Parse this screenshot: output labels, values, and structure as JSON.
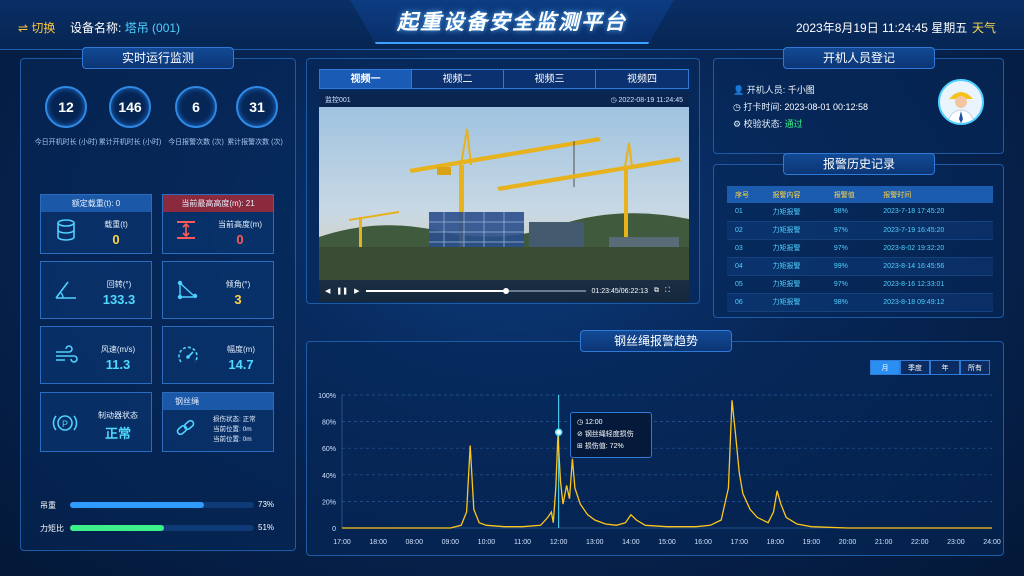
{
  "header": {
    "switch_label": "⇌ 切换",
    "device_label": "设备名称:",
    "device_name": "塔吊 (001)",
    "title": "起重设备安全监测平台",
    "datetime": "2023年8月19日 11:24:45 星期五",
    "weather": "天气"
  },
  "realtime": {
    "title": "实时运行监测",
    "stats": [
      {
        "value": "12",
        "label": "今日开机时长 (小时)"
      },
      {
        "value": "146",
        "label": "累计开机时长 (小时)"
      },
      {
        "value": "6",
        "label": "今日报警次数 (次)"
      },
      {
        "value": "31",
        "label": "累计报警次数 (次)"
      }
    ],
    "rated_load_head": "额定载重(t): 0",
    "load_label": "载重(t)",
    "load_value": "0",
    "max_height_head": "当前最高高度(m): 21",
    "height_label": "当前高度(m)",
    "height_value": "0",
    "slew_label": "回转(°)",
    "slew_value": "133.3",
    "tilt_label": "倾角(°)",
    "tilt_value": "3",
    "wind_label": "风速(m/s)",
    "wind_value": "11.3",
    "amplitude_label": "幅度(m)",
    "amplitude_value": "14.7",
    "brake_label": "制动器状态",
    "brake_value": "正常",
    "rope_head": "钢丝绳",
    "rope_lines": [
      "损伤状态: 正常",
      "当前位置: 0m",
      "当前位置: 0m"
    ],
    "bars": [
      {
        "label": "吊重",
        "percent": 73,
        "percent_text": "73%",
        "color": "#2f9bff"
      },
      {
        "label": "力矩比",
        "percent": 51,
        "percent_text": "51%",
        "color": "#3ef08a"
      }
    ]
  },
  "video": {
    "tabs": [
      "视频一",
      "视频二",
      "视频三",
      "视频四"
    ],
    "active_tab": 0,
    "camera_name": "监控001",
    "timestamp": "2022-08-19  11:24:45",
    "time_readout": "01:23:45/06:22:13",
    "progress": 0.64
  },
  "operator": {
    "title": "开机人员登记",
    "person_label": "开机人员:",
    "person_value": "千小图",
    "checkin_label": "打卡时间:",
    "checkin_value": "2023-08-01  00:12:58",
    "verify_label": "校验状态:",
    "verify_value": "通过"
  },
  "history": {
    "title": "报警历史记录",
    "columns": [
      "序号",
      "报警内容",
      "报警值",
      "报警时间"
    ],
    "rows": [
      [
        "01",
        "力矩报警",
        "98%",
        "2023-7-18  17:45:20"
      ],
      [
        "02",
        "力矩报警",
        "97%",
        "2023-7-19  16:45:20"
      ],
      [
        "03",
        "力矩报警",
        "97%",
        "2023-8-02  19:32:20"
      ],
      [
        "04",
        "力矩报警",
        "99%",
        "2023-8-14  16:45:56"
      ],
      [
        "05",
        "力矩报警",
        "97%",
        "2023-8-16  12:33:01"
      ],
      [
        "06",
        "力矩报警",
        "98%",
        "2023-8-18  09:49:12"
      ]
    ]
  },
  "trend": {
    "title": "钢丝绳报警趋势",
    "ranges": [
      "月",
      "季度",
      "年",
      "所有"
    ],
    "active_range": 0,
    "tooltip_time": "12:00",
    "tooltip_text": "钢丝绳轻度损伤",
    "tooltip_value": "损伤值: 72%"
  },
  "chart_data": {
    "type": "line",
    "x_labels": [
      "17:00",
      "18:00",
      "08:00",
      "09:00",
      "10:00",
      "11:00",
      "12:00",
      "13:00",
      "14:00",
      "15:00",
      "16:00",
      "17:00",
      "18:00",
      "19:00",
      "20:00",
      "21:00",
      "22:00",
      "23:00",
      "24:00"
    ],
    "y_ticks": [
      "0",
      "20%",
      "40%",
      "60%",
      "80%",
      "100%"
    ],
    "ylim": [
      0,
      100
    ],
    "line_color": "#ffc61a",
    "highlight_x": 6,
    "points": [
      [
        0,
        0
      ],
      [
        1,
        0
      ],
      [
        2,
        0
      ],
      [
        3,
        0
      ],
      [
        3.3,
        2
      ],
      [
        3.45,
        12
      ],
      [
        3.55,
        62
      ],
      [
        3.65,
        14
      ],
      [
        3.8,
        4
      ],
      [
        4.0,
        2
      ],
      [
        4.5,
        1
      ],
      [
        5.0,
        1
      ],
      [
        5.5,
        2
      ],
      [
        5.7,
        8
      ],
      [
        5.8,
        12
      ],
      [
        5.85,
        4
      ],
      [
        5.92,
        30
      ],
      [
        5.98,
        70
      ],
      [
        6.05,
        35
      ],
      [
        6.12,
        18
      ],
      [
        6.22,
        32
      ],
      [
        6.3,
        22
      ],
      [
        6.38,
        52
      ],
      [
        6.45,
        30
      ],
      [
        6.6,
        18
      ],
      [
        6.8,
        10
      ],
      [
        7.0,
        6
      ],
      [
        7.3,
        3
      ],
      [
        7.6,
        2
      ],
      [
        7.85,
        4
      ],
      [
        8.0,
        10
      ],
      [
        8.15,
        6
      ],
      [
        8.4,
        2
      ],
      [
        9.0,
        1
      ],
      [
        9.8,
        1
      ],
      [
        10.2,
        2
      ],
      [
        10.5,
        6
      ],
      [
        10.7,
        30
      ],
      [
        10.8,
        96
      ],
      [
        10.9,
        70
      ],
      [
        11.0,
        42
      ],
      [
        11.1,
        26
      ],
      [
        11.3,
        14
      ],
      [
        11.5,
        8
      ],
      [
        11.8,
        4
      ],
      [
        11.95,
        12
      ],
      [
        12.05,
        28
      ],
      [
        12.15,
        18
      ],
      [
        12.3,
        8
      ],
      [
        12.6,
        3
      ],
      [
        13.0,
        1
      ],
      [
        14,
        0
      ],
      [
        15,
        0
      ],
      [
        16,
        0
      ],
      [
        17,
        0
      ],
      [
        18,
        0
      ]
    ]
  }
}
